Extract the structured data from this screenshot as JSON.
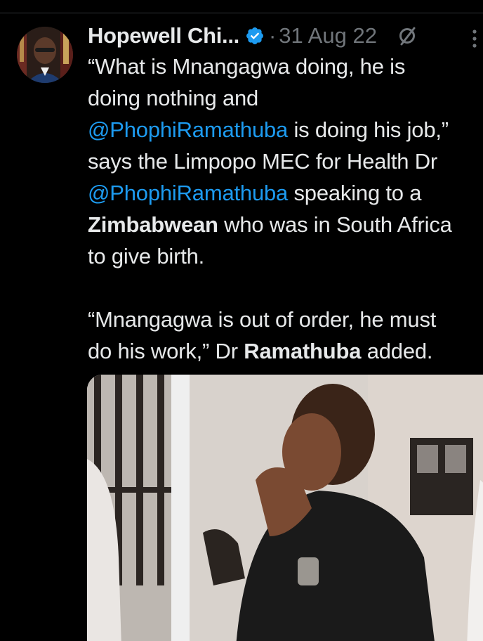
{
  "tweet": {
    "display_name": "Hopewell Chi...",
    "separator": "·",
    "date": "31 Aug 22",
    "icons": {
      "verified": "verified-badge-icon",
      "grok": "grok-icon",
      "more": "more-vertical-icon"
    },
    "body": {
      "line1": "“What is Mnangagwa doing, he is",
      "line2": "doing nothing and",
      "line3_mention": "@PhophiRamathuba",
      "line3_rest": " is doing his job,”",
      "line4": "says the Limpopo MEC for Health Dr",
      "line5_mention": "@PhophiRamathuba",
      "line5_rest": " speaking to a",
      "line6_bold": "Zimbabwean",
      "line6_rest": " who was in South Africa",
      "line7": "to give birth.",
      "line8": "“Mnangagwa is out of order, he must",
      "line9_a": "do his work,” Dr ",
      "line9_bold": "Ramathuba",
      "line9_rest": " added."
    }
  },
  "colors": {
    "background": "#000000",
    "text": "#e7e9ea",
    "muted": "#71767b",
    "link": "#1d9bf0"
  }
}
